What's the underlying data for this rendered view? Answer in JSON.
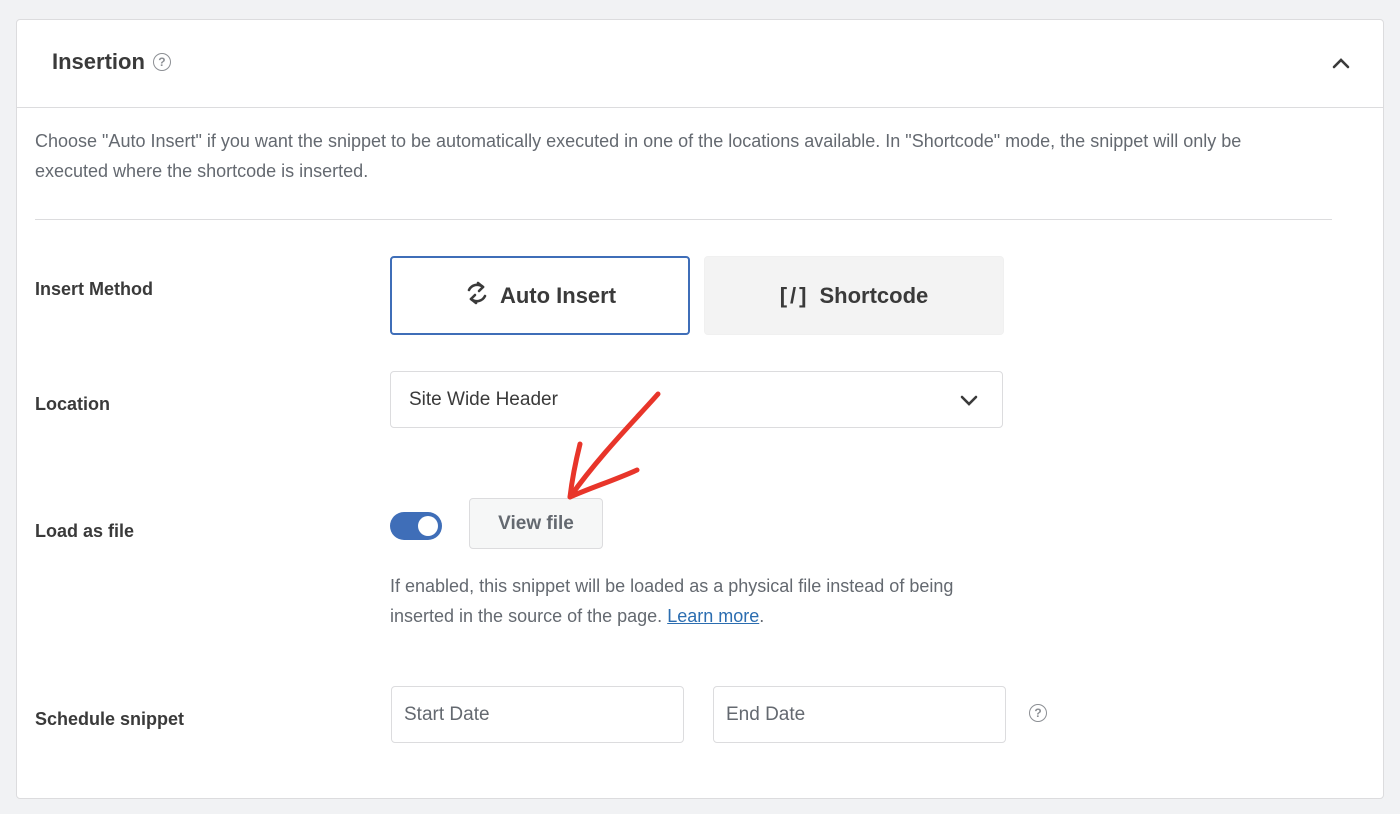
{
  "panel": {
    "title": "Insertion",
    "help_icon": "question-circle-icon",
    "collapse_icon": "chevron-up-icon",
    "description": "Choose \"Auto Insert\" if you want the snippet to be automatically executed in one of the locations available. In \"Shortcode\" mode, the snippet will only be executed where the shortcode is inserted."
  },
  "insert_method": {
    "label": "Insert Method",
    "options": [
      {
        "label": "Auto Insert",
        "icon": "sync-icon",
        "selected": true
      },
      {
        "label": "Shortcode",
        "icon": "[/]",
        "selected": false
      }
    ]
  },
  "location": {
    "label": "Location",
    "selected": "Site Wide Header"
  },
  "load_as_file": {
    "label": "Load as file",
    "enabled": true,
    "view_button": "View file",
    "help_text": "If enabled, this snippet will be loaded as a physical file instead of being inserted in the source of the page. ",
    "link_text": "Learn more",
    "after_link": "."
  },
  "schedule": {
    "label": "Schedule snippet",
    "start_placeholder": "Start Date",
    "end_placeholder": "End Date"
  },
  "colors": {
    "accent": "#3f6eb8",
    "annotation_arrow": "#e8352a",
    "link": "#2b6db0"
  }
}
